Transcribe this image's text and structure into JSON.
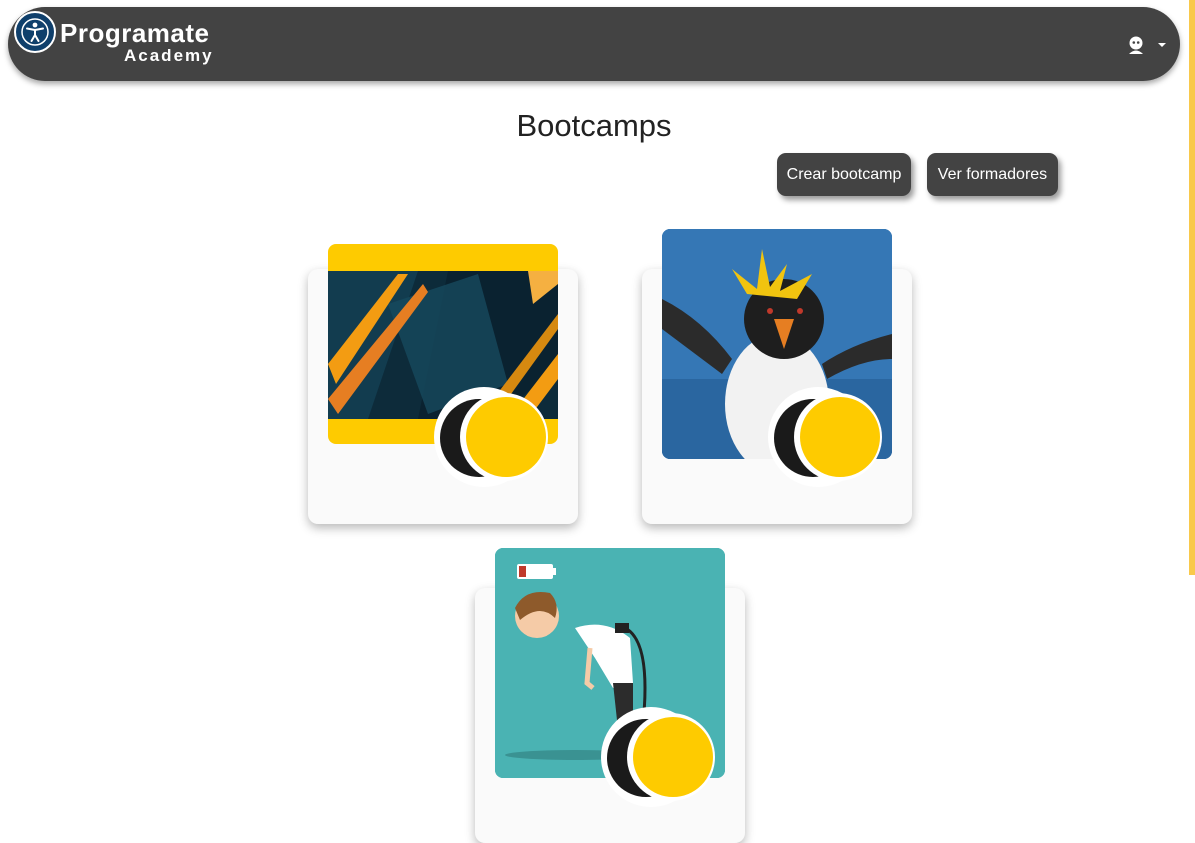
{
  "header": {
    "brand_main": "Programate",
    "brand_sub": "Academy",
    "accessibility_icon": "accessibility-icon",
    "user_icon": "user-icon",
    "menu_icon": "chevron-down-icon"
  },
  "page": {
    "title": "Bootcamps"
  },
  "actions": {
    "create_label": "Crear bootcamp",
    "trainers_label": "Ver formadores"
  },
  "cards": [
    {
      "image": "abstract-gold-geometric",
      "badge_icon": "coin-icon"
    },
    {
      "image": "rockhopper-penguin",
      "badge_icon": "coin-icon"
    },
    {
      "image": "tired-man-low-battery",
      "badge_icon": "coin-icon"
    }
  ],
  "colors": {
    "navbar": "#434343",
    "accent_yellow": "#fecb00",
    "button": "#434343",
    "card_bg": "#fafafa"
  }
}
